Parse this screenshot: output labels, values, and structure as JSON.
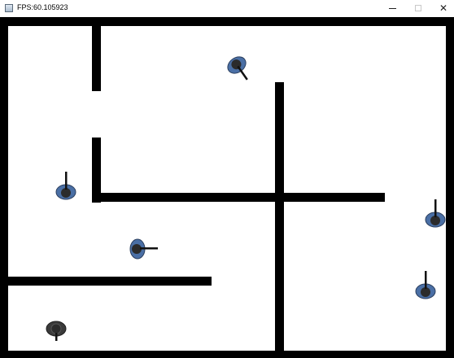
{
  "window": {
    "title": "FPS:60.105923",
    "controls": {
      "minimize": "minimize",
      "maximize": "maximize",
      "close": "close"
    }
  },
  "game": {
    "background_color": "#ffffff",
    "wall_color": "#000000",
    "soldier_colors": {
      "body": "#4a6fa5",
      "head": "#2b2b2b",
      "rifle": "#111111",
      "player_body": "#3a3a3a"
    },
    "walls": [
      "outer-top",
      "outer-bottom",
      "outer-left",
      "outer-right",
      "upper-left-divider-top",
      "upper-left-divider-bottom",
      "middle-horizontal",
      "center-vertical",
      "lower-left-horizontal"
    ],
    "soldiers": [
      {
        "id": "enemy-top-center",
        "type": "enemy",
        "facing": "down-right"
      },
      {
        "id": "enemy-left",
        "type": "enemy",
        "facing": "up"
      },
      {
        "id": "enemy-middle",
        "type": "enemy",
        "facing": "right"
      },
      {
        "id": "enemy-right-upper",
        "type": "enemy",
        "facing": "up"
      },
      {
        "id": "enemy-right-lower",
        "type": "enemy",
        "facing": "up"
      },
      {
        "id": "player-bottom-left",
        "type": "player",
        "facing": "down"
      }
    ]
  }
}
